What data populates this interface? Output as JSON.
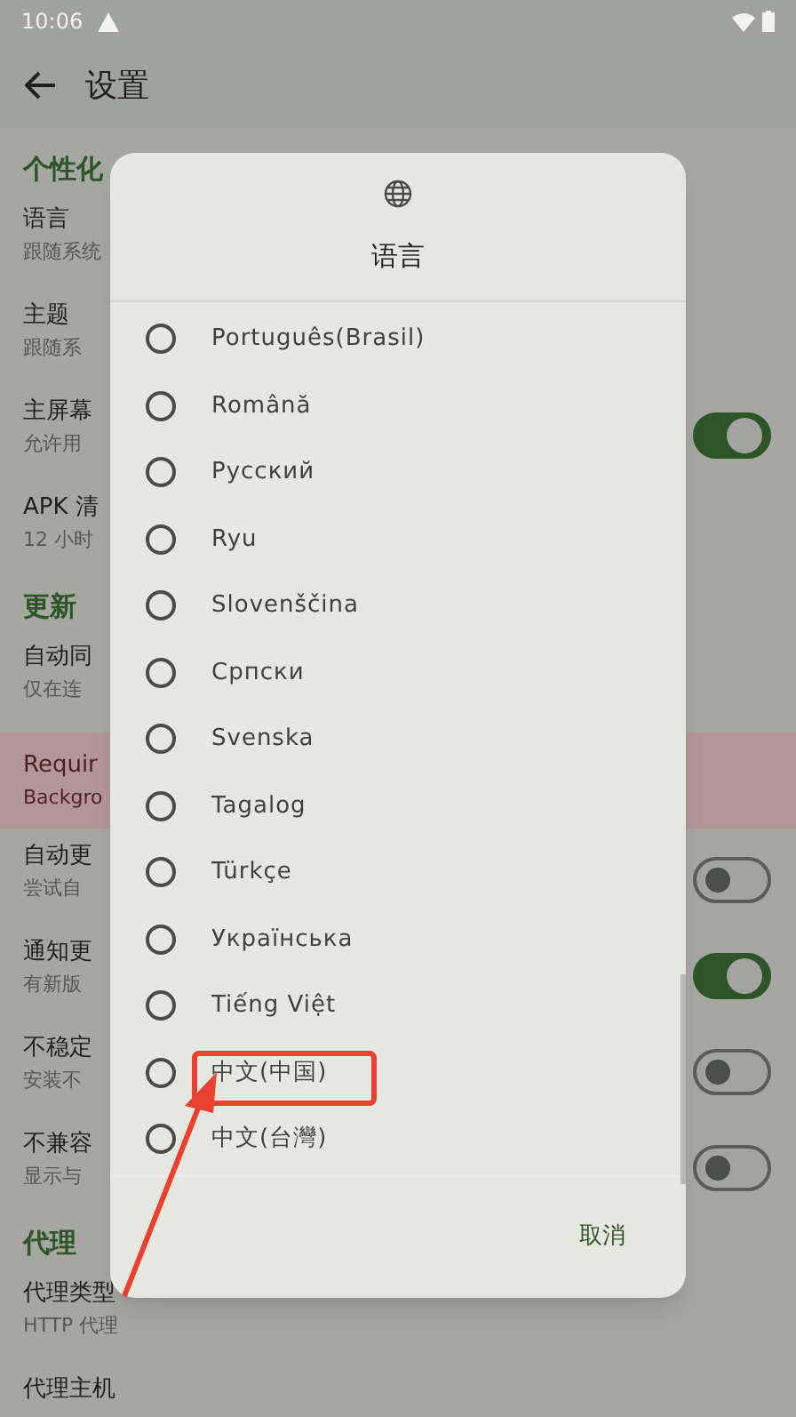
{
  "status_bar": {
    "time": "10:06"
  },
  "app_bar": {
    "title": "设置"
  },
  "settings": [
    {
      "kind": "header",
      "title": "个性化"
    },
    {
      "kind": "item",
      "title": "语言",
      "subtitle": "跟随系统"
    },
    {
      "kind": "item",
      "title": "主题",
      "subtitle": "跟随系"
    },
    {
      "kind": "item",
      "title": "主屏幕",
      "subtitle": "允许用",
      "toggle": {
        "on": true
      }
    },
    {
      "kind": "item",
      "title": "APK 清",
      "subtitle": "12 小时"
    },
    {
      "kind": "header",
      "title": "更新"
    },
    {
      "kind": "item",
      "title": "自动同",
      "subtitle": "仅在连"
    },
    {
      "kind": "warning",
      "title": "Requir",
      "subtitle": "Backgro"
    },
    {
      "kind": "item",
      "title": "自动更",
      "subtitle": "尝试自",
      "toggle": {
        "on": false
      }
    },
    {
      "kind": "item",
      "title": "通知更",
      "subtitle": "有新版",
      "toggle": {
        "on": true
      }
    },
    {
      "kind": "item",
      "title": "不稳定",
      "subtitle": "安装不",
      "toggle": {
        "on": false
      }
    },
    {
      "kind": "item",
      "title": "不兼容",
      "subtitle": "显示与",
      "toggle": {
        "on": false
      }
    },
    {
      "kind": "header",
      "title": "代理"
    },
    {
      "kind": "item",
      "title": "代理类型",
      "subtitle": "HTTP 代理"
    },
    {
      "kind": "item",
      "title": "代理主机"
    }
  ],
  "dialog": {
    "title": "语言",
    "options": [
      {
        "label": "Português(Brasil)",
        "selected": false
      },
      {
        "label": "Română",
        "selected": false
      },
      {
        "label": "Русский",
        "selected": false
      },
      {
        "label": "Ryu",
        "selected": false
      },
      {
        "label": "Slovenščina",
        "selected": false
      },
      {
        "label": "Српски",
        "selected": false
      },
      {
        "label": "Svenska",
        "selected": false
      },
      {
        "label": "Tagalog",
        "selected": false
      },
      {
        "label": "Türkçe",
        "selected": false
      },
      {
        "label": "Українська",
        "selected": false
      },
      {
        "label": "Tiếng Việt",
        "selected": false
      },
      {
        "label": "中文(中国)",
        "selected": false
      },
      {
        "label": "中文(台灣)",
        "selected": false
      }
    ],
    "cancel": "取消"
  }
}
